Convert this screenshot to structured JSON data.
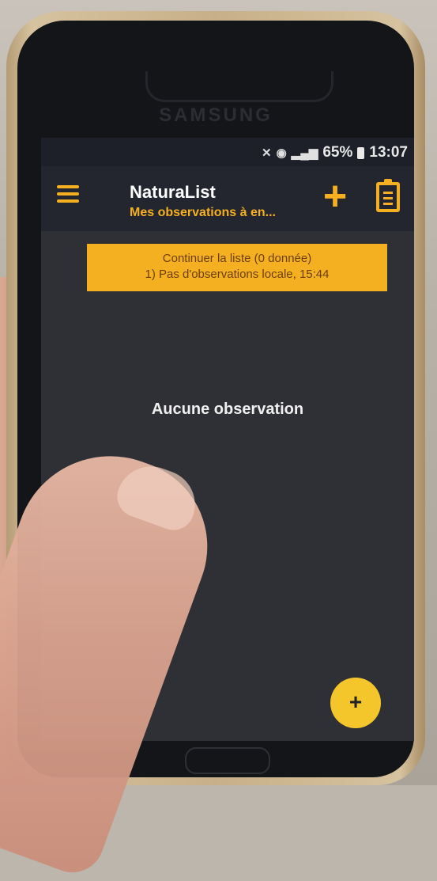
{
  "status_bar": {
    "battery": "65%",
    "time": "13:07",
    "icons": [
      "mute-icon",
      "wifi-icon",
      "signal-icon",
      "battery-icon"
    ]
  },
  "device": {
    "brand": "SAMSUNG"
  },
  "app_bar": {
    "title": "NaturaList",
    "subtitle": "Mes observations à en...",
    "icons": [
      "menu-icon",
      "plus-icon",
      "clipboard-icon"
    ]
  },
  "banner": {
    "line1": "Continuer la liste (0 donnée)",
    "line2": "1) Pas d'observations locale, 15:44"
  },
  "main": {
    "empty_text": "Aucune observation"
  },
  "fab": {
    "label": "+"
  },
  "colors": {
    "accent": "#f5b021",
    "appbar": "#23252f",
    "screen": "#2f3035",
    "fab": "#f5c52c"
  }
}
